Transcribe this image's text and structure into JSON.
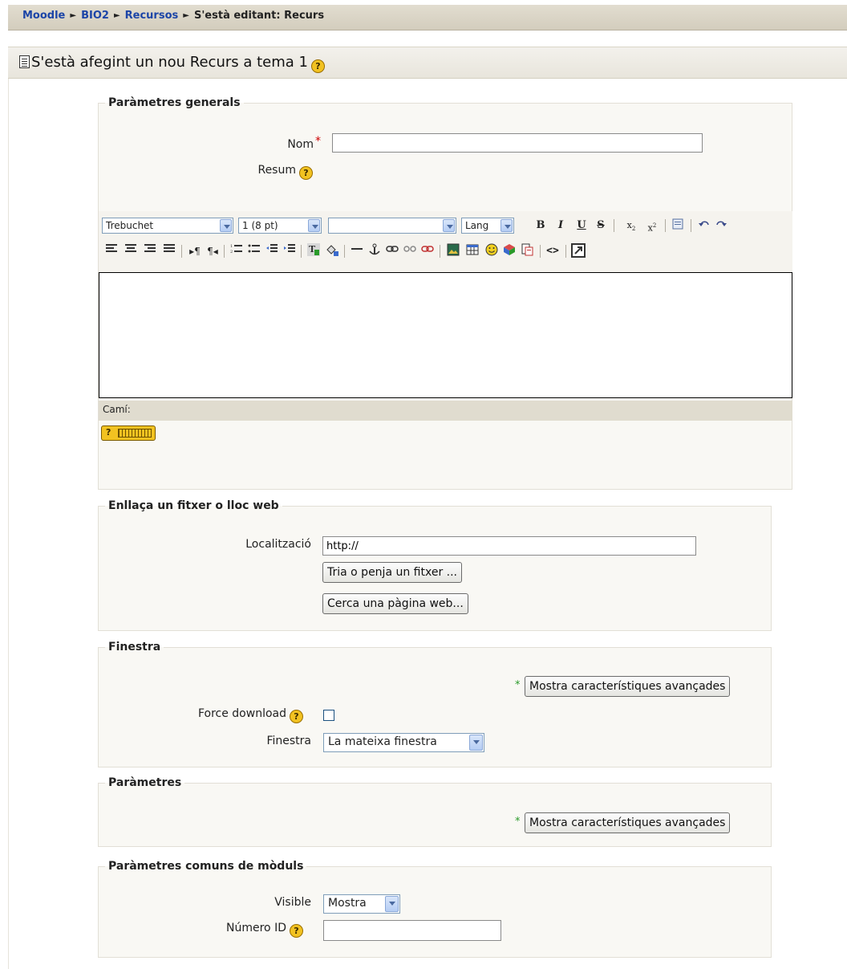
{
  "breadcrumb": {
    "home": "Moodle",
    "course": "BIO2",
    "section": "Recursos",
    "current": "S'està editant: Recurs",
    "separator": "►"
  },
  "page_title": "S'està afegint un nou Recurs a tema 1",
  "help_symbol": "?",
  "general": {
    "legend": "Paràmetres generals",
    "name_label": "Nom",
    "name_value": "",
    "required_mark": "*",
    "summary_label": "Resum",
    "editor": {
      "font": "Trebuchet",
      "size": "1 (8 pt)",
      "format": "",
      "lang": "Lang",
      "path_label": "Camí:"
    }
  },
  "link": {
    "legend": "Enllaça un fitxer o lloc web",
    "location_label": "Localització",
    "location_value": "http://",
    "choose_button": "Tria o penja un fitxer ...",
    "search_button": "Cerca una pàgina web..."
  },
  "window": {
    "legend": "Finestra",
    "advanced_button": "Mostra característiques avançades",
    "force_download_label": "Force download",
    "force_download_checked": false,
    "window_label": "Finestra",
    "window_value": "La mateixa finestra"
  },
  "params": {
    "legend": "Paràmetres",
    "advanced_button": "Mostra característiques avançades"
  },
  "common": {
    "legend": "Paràmetres comuns de mòduls",
    "visible_label": "Visible",
    "visible_value": "Mostra",
    "id_label": "Número ID",
    "id_value": ""
  },
  "colors": {
    "link": "#1c45a7",
    "required": "#cc0000",
    "advanced_star": "#2a9a2a",
    "help_icon": "#f2c221"
  }
}
